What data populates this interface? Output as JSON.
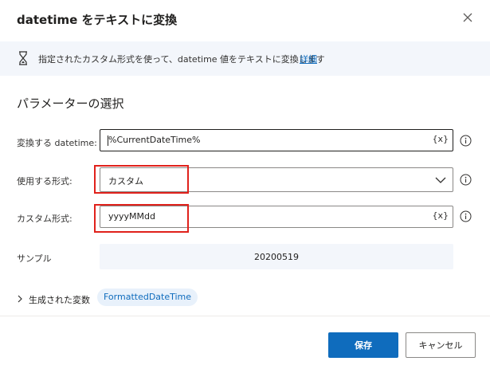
{
  "dialog": {
    "title": "datetime をテキストに変換"
  },
  "info": {
    "text": "指定されたカスタム形式を使って、datetime 値をテキストに変換します",
    "link": "詳細"
  },
  "section": {
    "title": "パラメーターの選択"
  },
  "fields": {
    "datetime": {
      "label": "変換する datetime:",
      "value": "%CurrentDateTime%",
      "var_token": "{x}"
    },
    "format": {
      "label": "使用する形式:",
      "value": "カスタム"
    },
    "custom_format": {
      "label": "カスタム形式:",
      "value": "yyyyMMdd",
      "var_token": "{x}"
    },
    "sample": {
      "label": "サンプル",
      "value": "20200519"
    }
  },
  "generated": {
    "label": "生成された変数",
    "variable": "FormattedDateTime"
  },
  "buttons": {
    "save": "保存",
    "cancel": "キャンセル"
  },
  "colors": {
    "accent": "#0f6cbd",
    "highlight": "#e0211b",
    "info_bg": "#f3f6fb"
  }
}
